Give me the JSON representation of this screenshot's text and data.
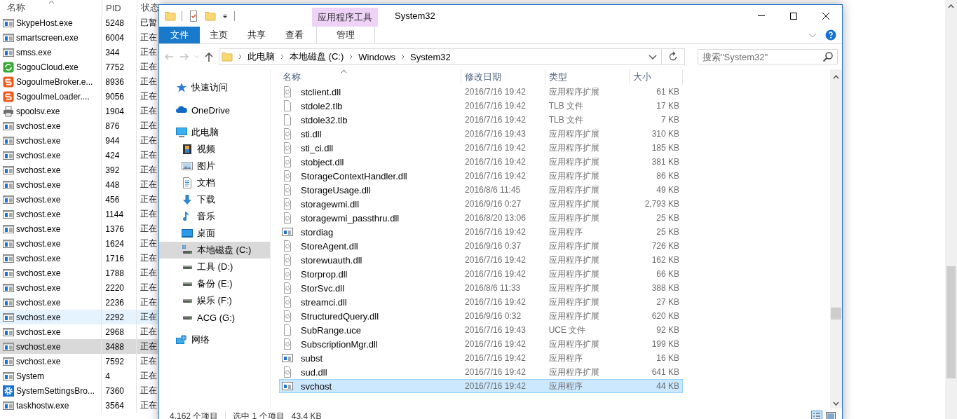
{
  "task_manager": {
    "columns": [
      "名称",
      "PID",
      "状态"
    ],
    "rows": [
      {
        "name": "SkypeHost.exe",
        "pid": "5248",
        "status": "已暂",
        "kind": "app",
        "selected": false,
        "hovered": false
      },
      {
        "name": "smartscreen.exe",
        "pid": "6004",
        "status": "正在",
        "kind": "app",
        "selected": false,
        "hovered": false
      },
      {
        "name": "smss.exe",
        "pid": "344",
        "status": "正在",
        "kind": "app",
        "selected": false,
        "hovered": false
      },
      {
        "name": "SogouCloud.exe",
        "pid": "7752",
        "status": "正在",
        "kind": "cloud-sync",
        "selected": false,
        "hovered": false
      },
      {
        "name": "SogouImeBroker.e...",
        "pid": "8936",
        "status": "正在",
        "kind": "ime",
        "selected": false,
        "hovered": false
      },
      {
        "name": "SogouImeLoader....",
        "pid": "9056",
        "status": "正在",
        "kind": "ime",
        "selected": false,
        "hovered": false
      },
      {
        "name": "spoolsv.exe",
        "pid": "1904",
        "status": "正在",
        "kind": "printer",
        "selected": false,
        "hovered": false
      },
      {
        "name": "svchost.exe",
        "pid": "876",
        "status": "正在",
        "kind": "app",
        "selected": false,
        "hovered": false
      },
      {
        "name": "svchost.exe",
        "pid": "944",
        "status": "正在",
        "kind": "app",
        "selected": false,
        "hovered": false
      },
      {
        "name": "svchost.exe",
        "pid": "424",
        "status": "正在",
        "kind": "app",
        "selected": false,
        "hovered": false
      },
      {
        "name": "svchost.exe",
        "pid": "392",
        "status": "正在",
        "kind": "app",
        "selected": false,
        "hovered": false
      },
      {
        "name": "svchost.exe",
        "pid": "448",
        "status": "正在",
        "kind": "app",
        "selected": false,
        "hovered": false
      },
      {
        "name": "svchost.exe",
        "pid": "456",
        "status": "正在",
        "kind": "app",
        "selected": false,
        "hovered": false
      },
      {
        "name": "svchost.exe",
        "pid": "1144",
        "status": "正在",
        "kind": "app",
        "selected": false,
        "hovered": false
      },
      {
        "name": "svchost.exe",
        "pid": "1376",
        "status": "正在",
        "kind": "app",
        "selected": false,
        "hovered": false
      },
      {
        "name": "svchost.exe",
        "pid": "1624",
        "status": "正在",
        "kind": "app",
        "selected": false,
        "hovered": false
      },
      {
        "name": "svchost.exe",
        "pid": "1716",
        "status": "正在",
        "kind": "app",
        "selected": false,
        "hovered": false
      },
      {
        "name": "svchost.exe",
        "pid": "1788",
        "status": "正在",
        "kind": "app",
        "selected": false,
        "hovered": false
      },
      {
        "name": "svchost.exe",
        "pid": "2220",
        "status": "正在",
        "kind": "app",
        "selected": false,
        "hovered": false
      },
      {
        "name": "svchost.exe",
        "pid": "2236",
        "status": "正在",
        "kind": "app",
        "selected": false,
        "hovered": false
      },
      {
        "name": "svchost.exe",
        "pid": "2292",
        "status": "正在",
        "kind": "app",
        "selected": false,
        "hovered": true
      },
      {
        "name": "svchost.exe",
        "pid": "2968",
        "status": "正在",
        "kind": "app",
        "selected": false,
        "hovered": false
      },
      {
        "name": "svchost.exe",
        "pid": "3488",
        "status": "正在",
        "kind": "app",
        "selected": true,
        "hovered": false
      },
      {
        "name": "svchost.exe",
        "pid": "7592",
        "status": "正在",
        "kind": "app",
        "selected": false,
        "hovered": false
      },
      {
        "name": "System",
        "pid": "4",
        "status": "正在",
        "kind": "app",
        "selected": false,
        "hovered": false
      },
      {
        "name": "SystemSettingsBro...",
        "pid": "7360",
        "status": "正在",
        "kind": "gear",
        "selected": false,
        "hovered": false
      },
      {
        "name": "taskhostw.exe",
        "pid": "3564",
        "status": "正在",
        "kind": "app",
        "selected": false,
        "hovered": false
      }
    ]
  },
  "explorer": {
    "window": {
      "title": "System32"
    },
    "ribbon": {
      "context_group": "应用程序工具",
      "tabs": [
        {
          "label": "文件",
          "kind": "file"
        },
        {
          "label": "主页",
          "kind": "tab"
        },
        {
          "label": "共享",
          "kind": "tab"
        },
        {
          "label": "查看",
          "kind": "tab"
        },
        {
          "label": "管理",
          "kind": "context"
        }
      ]
    },
    "address": {
      "crumbs": [
        "此电脑",
        "本地磁盘 (C:)",
        "Windows",
        "System32"
      ]
    },
    "search": {
      "placeholder": "搜索\"System32\""
    },
    "nav": [
      {
        "label": "快速访问",
        "kind": "star",
        "selected": false
      },
      {
        "label": "OneDrive",
        "kind": "cloud",
        "selected": false
      },
      {
        "label": "此电脑",
        "kind": "pc",
        "selected": false,
        "children": [
          {
            "label": "视频",
            "kind": "video",
            "selected": false
          },
          {
            "label": "图片",
            "kind": "image",
            "selected": false
          },
          {
            "label": "文档",
            "kind": "doc",
            "selected": false
          },
          {
            "label": "下载",
            "kind": "download",
            "selected": false
          },
          {
            "label": "音乐",
            "kind": "music",
            "selected": false
          },
          {
            "label": "桌面",
            "kind": "desktop",
            "selected": false
          },
          {
            "label": "本地磁盘 (C:)",
            "kind": "system-drive",
            "selected": true
          },
          {
            "label": "工具 (D:)",
            "kind": "drive",
            "selected": false
          },
          {
            "label": "备份 (E:)",
            "kind": "drive",
            "selected": false
          },
          {
            "label": "娱乐 (F:)",
            "kind": "drive",
            "selected": false
          },
          {
            "label": "ACG (G:)",
            "kind": "drive",
            "selected": false
          }
        ]
      },
      {
        "label": "网络",
        "kind": "network",
        "selected": false
      }
    ],
    "table": {
      "columns": [
        "名称",
        "修改日期",
        "类型",
        "大小"
      ],
      "rows": [
        {
          "name": "stclient.dll",
          "date": "2016/7/16 19:42",
          "type": "应用程序扩展",
          "size": "61 KB",
          "kind": "dll",
          "selected": false
        },
        {
          "name": "stdole2.tlb",
          "date": "2016/7/16 19:42",
          "type": "TLB 文件",
          "size": "17 KB",
          "kind": "blank",
          "selected": false
        },
        {
          "name": "stdole32.tlb",
          "date": "2016/7/16 19:42",
          "type": "TLB 文件",
          "size": "7 KB",
          "kind": "blank",
          "selected": false
        },
        {
          "name": "sti.dll",
          "date": "2016/7/16 19:43",
          "type": "应用程序扩展",
          "size": "310 KB",
          "kind": "dll",
          "selected": false
        },
        {
          "name": "sti_ci.dll",
          "date": "2016/7/16 19:42",
          "type": "应用程序扩展",
          "size": "185 KB",
          "kind": "dll",
          "selected": false
        },
        {
          "name": "stobject.dll",
          "date": "2016/7/16 19:42",
          "type": "应用程序扩展",
          "size": "381 KB",
          "kind": "dll",
          "selected": false
        },
        {
          "name": "StorageContextHandler.dll",
          "date": "2016/7/16 19:42",
          "type": "应用程序扩展",
          "size": "86 KB",
          "kind": "dll",
          "selected": false
        },
        {
          "name": "StorageUsage.dll",
          "date": "2016/8/6 11:45",
          "type": "应用程序扩展",
          "size": "49 KB",
          "kind": "dll",
          "selected": false
        },
        {
          "name": "storagewmi.dll",
          "date": "2016/9/16 0:27",
          "type": "应用程序扩展",
          "size": "2,793 KB",
          "kind": "dll",
          "selected": false
        },
        {
          "name": "storagewmi_passthru.dll",
          "date": "2016/8/20 13:06",
          "type": "应用程序扩展",
          "size": "25 KB",
          "kind": "dll",
          "selected": false
        },
        {
          "name": "stordiag",
          "date": "2016/7/16 19:42",
          "type": "应用程序",
          "size": "25 KB",
          "kind": "exe",
          "selected": false
        },
        {
          "name": "StoreAgent.dll",
          "date": "2016/9/16 0:37",
          "type": "应用程序扩展",
          "size": "726 KB",
          "kind": "dll",
          "selected": false
        },
        {
          "name": "storewuauth.dll",
          "date": "2016/7/16 19:42",
          "type": "应用程序扩展",
          "size": "162 KB",
          "kind": "dll",
          "selected": false
        },
        {
          "name": "Storprop.dll",
          "date": "2016/7/16 19:42",
          "type": "应用程序扩展",
          "size": "66 KB",
          "kind": "dll",
          "selected": false
        },
        {
          "name": "StorSvc.dll",
          "date": "2016/8/6 11:33",
          "type": "应用程序扩展",
          "size": "388 KB",
          "kind": "dll",
          "selected": false
        },
        {
          "name": "streamci.dll",
          "date": "2016/7/16 19:42",
          "type": "应用程序扩展",
          "size": "27 KB",
          "kind": "dll",
          "selected": false
        },
        {
          "name": "StructuredQuery.dll",
          "date": "2016/9/16 0:32",
          "type": "应用程序扩展",
          "size": "620 KB",
          "kind": "dll",
          "selected": false
        },
        {
          "name": "SubRange.uce",
          "date": "2016/7/16 19:43",
          "type": "UCE 文件",
          "size": "92 KB",
          "kind": "blank",
          "selected": false
        },
        {
          "name": "SubscriptionMgr.dll",
          "date": "2016/7/16 19:42",
          "type": "应用程序扩展",
          "size": "199 KB",
          "kind": "dll",
          "selected": false
        },
        {
          "name": "subst",
          "date": "2016/7/16 19:42",
          "type": "应用程序",
          "size": "16 KB",
          "kind": "exe",
          "selected": false
        },
        {
          "name": "sud.dll",
          "date": "2016/7/16 19:42",
          "type": "应用程序扩展",
          "size": "641 KB",
          "kind": "dll",
          "selected": false
        },
        {
          "name": "svchost",
          "date": "2016/7/16 19:42",
          "type": "应用程序",
          "size": "44 KB",
          "kind": "exe",
          "selected": true
        }
      ]
    },
    "status_bar": {
      "item_count": "4,162 个项目",
      "selection": "选中 1 个项目",
      "selection_size": "43.4 KB"
    }
  }
}
